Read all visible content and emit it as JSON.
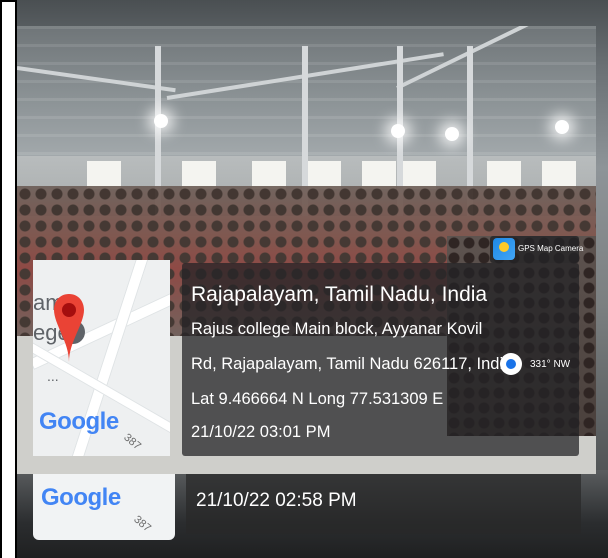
{
  "overlay": {
    "app_badge": "GPS Map Camera",
    "place_title": "Rajapalayam, Tamil Nadu, India",
    "address_line_1": "Rajus college Main block, Ayyanar Kovil",
    "address_line_2": "Rd, Rajapalayam, Tamil Nadu 626117, India",
    "heading": "331° NW",
    "coordinates": "Lat 9.466664 N Long 77.531309 E",
    "timestamp": "21/10/22 03:01 PM"
  },
  "map": {
    "label_top": "am",
    "label_mid": "ege",
    "label_dots": "...",
    "logo": "Google",
    "road_number": "387"
  },
  "back_photo": {
    "logo": "Google",
    "road_number": "387",
    "timestamp": "21/10/22 02:58 PM"
  },
  "colors": {
    "pin": "#ea4335",
    "overlay_bg": "#232326"
  }
}
